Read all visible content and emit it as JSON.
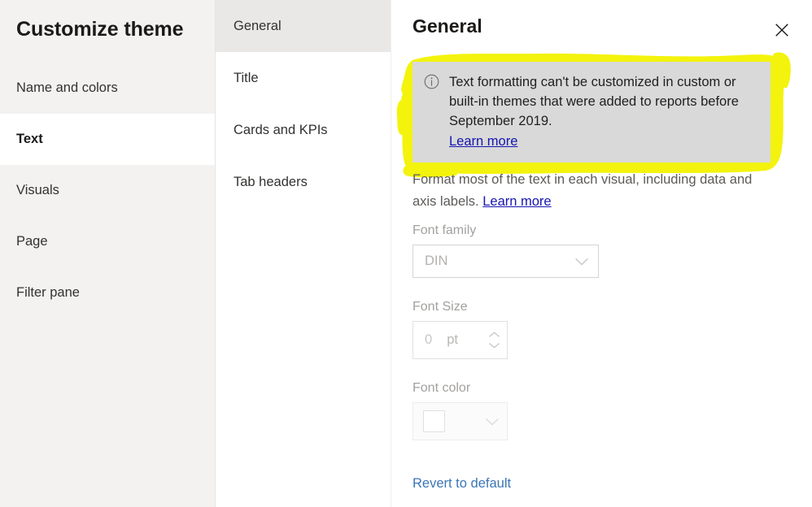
{
  "sidebar": {
    "title": "Customize theme",
    "items": [
      {
        "label": "Name and colors",
        "selected": false
      },
      {
        "label": "Text",
        "selected": true
      },
      {
        "label": "Visuals",
        "selected": false
      },
      {
        "label": "Page",
        "selected": false
      },
      {
        "label": "Filter pane",
        "selected": false
      }
    ]
  },
  "midcol": {
    "items": [
      {
        "label": "General",
        "selected": true
      },
      {
        "label": "Title",
        "selected": false
      },
      {
        "label": "Cards and KPIs",
        "selected": false
      },
      {
        "label": "Tab headers",
        "selected": false
      }
    ]
  },
  "detail": {
    "title": "General",
    "close_icon": "close-icon",
    "info": {
      "icon": "info-circle-icon",
      "message": "Text formatting can't be customized in custom or built-in themes that were added to reports before September 2019.",
      "link_label": "Learn more"
    },
    "description": {
      "text": "Format most of the text in each visual, including data and axis labels. ",
      "link_label": "Learn more"
    },
    "fields": {
      "font_family": {
        "label": "Font family",
        "value": "DIN",
        "placeholder": "DIN",
        "chevron_icon": "chevron-down-icon"
      },
      "font_size": {
        "label": "Font Size",
        "value": "0",
        "unit": "pt",
        "up_icon": "chevron-up-icon",
        "down_icon": "chevron-down-icon"
      },
      "font_color": {
        "label": "Font color",
        "swatch_color": "#ffffff",
        "chevron_icon": "chevron-down-icon"
      }
    },
    "revert_label": "Revert to default"
  },
  "annotation": {
    "highlight_color": "#f3f30d",
    "shape": "hand-drawn-marker-rectangle"
  }
}
